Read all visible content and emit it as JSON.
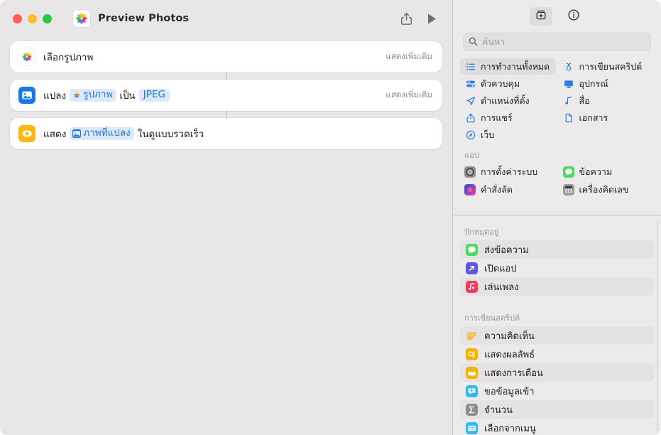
{
  "window": {
    "title": "Preview Photos",
    "app_icon": "photos-icon",
    "traffic_lights": [
      "close",
      "minimize",
      "zoom"
    ],
    "toolbar": {
      "share_icon": "share-icon",
      "run_icon": "play-icon"
    }
  },
  "flow": {
    "show_more_label": "แสดงเพิ่มเติม",
    "cards": [
      {
        "icon": "photos-icon",
        "words": [
          "เลือกรูปภาพ"
        ],
        "has_show_more": true
      },
      {
        "icon": "image-icon",
        "words": [
          "แปลง"
        ],
        "token1_label": "รูปภาพ",
        "word2": "เป็น",
        "token2_label": "JPEG",
        "has_show_more": true
      },
      {
        "icon": "eye-icon",
        "words": [
          "แสดง"
        ],
        "token1_label": "ภาพที่แปลง",
        "word2": "ในดูแบบรวดเร็ว",
        "has_show_more": false
      }
    ]
  },
  "library": {
    "toolbar": {
      "add_action_icon": "action-library-icon",
      "info_icon": "info-circle-icon"
    },
    "search": {
      "placeholder": "ค้นหา",
      "value": "",
      "icon": "search-icon"
    },
    "categories": [
      {
        "label": "การทำงานทั้งหมด",
        "icon": "list-bullet-icon",
        "selected": true
      },
      {
        "label": "การเขียนสคริปต์",
        "icon": "scroll-icon",
        "selected": false
      },
      {
        "label": "ตัวควบคุม",
        "icon": "sliders-icon",
        "selected": false
      },
      {
        "label": "อุปกรณ์",
        "icon": "display-icon",
        "selected": false
      },
      {
        "label": "ตำแหน่งที่ตั้ง",
        "icon": "location-arrow-icon",
        "selected": false
      },
      {
        "label": "สื่อ",
        "icon": "music-note-icon",
        "selected": false
      },
      {
        "label": "การแชร์",
        "icon": "share-icon",
        "selected": false
      },
      {
        "label": "เอกสาร",
        "icon": "document-icon",
        "selected": false
      },
      {
        "label": "เว็บ",
        "icon": "safari-compass-icon",
        "selected": false
      }
    ],
    "apps_section": {
      "header": "แอป",
      "items": [
        {
          "label": "การตั้งค่าระบบ",
          "icon": "system-settings-icon"
        },
        {
          "label": "ข้อความ",
          "icon": "messages-icon"
        },
        {
          "label": "คำสั่งลัด",
          "icon": "shortcuts-icon"
        },
        {
          "label": "เครื่องคิดเลข",
          "icon": "calculator-icon"
        }
      ]
    },
    "pinned_section": {
      "header": "ปักหมุดอยู่",
      "items": [
        {
          "label": "ส่งข้อความ",
          "icon": "messages-icon"
        },
        {
          "label": "เปิดแอป",
          "icon": "open-app-icon"
        },
        {
          "label": "เล่นเพลง",
          "icon": "music-icon"
        }
      ]
    },
    "scripting_section": {
      "header": "การเขียนสคริปต์",
      "items": [
        {
          "label": "ความคิดเห็น",
          "icon": "comment-icon"
        },
        {
          "label": "แสดงผลลัพธ์",
          "icon": "show-result-icon"
        },
        {
          "label": "แสดงการเตือน",
          "icon": "show-alert-icon"
        },
        {
          "label": "ขอข้อมูลเข้า",
          "icon": "ask-input-icon"
        },
        {
          "label": "จำนวน",
          "icon": "count-sigma-icon"
        },
        {
          "label": "เลือกจากเมนู",
          "icon": "choose-from-menu-icon"
        }
      ]
    }
  },
  "colors": {
    "accent_blue": "#1577e8",
    "token_bg": "#dbe9fb",
    "window_bg": "#e8e6e6",
    "library_bg": "#eceaea",
    "card_bg": "#ffffff"
  }
}
